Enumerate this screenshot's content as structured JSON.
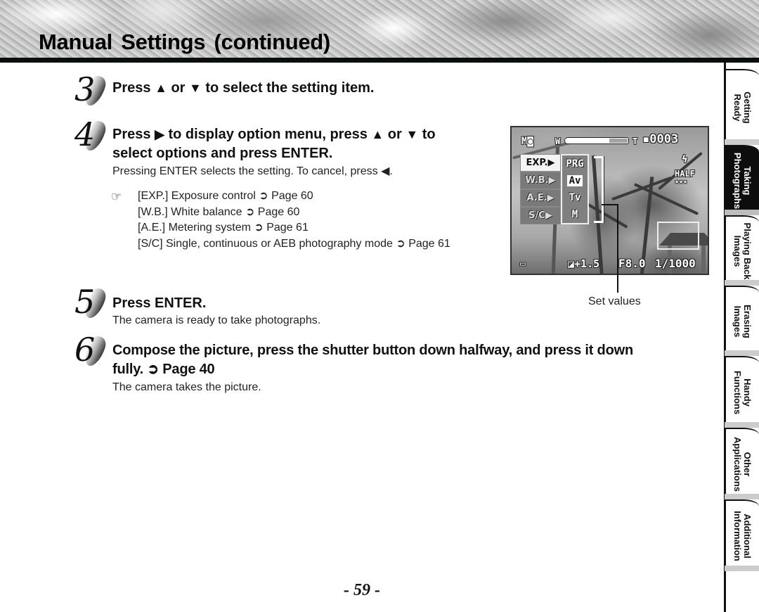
{
  "header": {
    "title": "Manual Settings (continued)"
  },
  "steps": [
    {
      "number": "3",
      "heading_parts": [
        "Press ",
        "▲",
        " or ",
        "▼",
        " to select the setting item."
      ]
    },
    {
      "number": "4",
      "heading_line1_parts": [
        "Press ",
        "▶",
        " to display option menu, press ",
        "▲",
        " or ",
        "▼",
        " to"
      ],
      "heading_line2": "select options and press ENTER.",
      "body": "Pressing ENTER selects the setting. To cancel, press ◀.",
      "note_icon": "☞",
      "notes": [
        "[EXP.] Exposure control ➲ Page 60",
        "[W.B.] White balance ➲ Page 60",
        "[A.E.] Metering system ➲ Page 61",
        "[S/C] Single, continuous or AEB photography mode ➲ Page 61"
      ]
    },
    {
      "number": "5",
      "heading": "Press ENTER.",
      "body": "The camera is ready to take photographs."
    },
    {
      "number": "6",
      "heading_line1": "Compose the picture, press the shutter button down halfway, and press it down",
      "heading_line2": "fully. ➲ Page 40",
      "body": "The camera takes the picture."
    }
  ],
  "lcd": {
    "mode": "M",
    "zoom_w": "W",
    "zoom_t": "T",
    "zoom_level": 0.7,
    "frame_count": "0003",
    "flash": "ϟ",
    "quality": "HALF",
    "quality_stars": "★★★",
    "menu_items": [
      "EXP.▶",
      "W.B.▶",
      "A.E.▶",
      "S/C▶"
    ],
    "selected_menu_index": 0,
    "options": [
      "PRG",
      "Av",
      "Tv",
      "M"
    ],
    "selected_option_index": 1,
    "exposure_comp": "+1.5",
    "aperture": "F8.0",
    "shutter": "1/1000",
    "annotation": "Set values"
  },
  "side_tabs": [
    {
      "label": "Getting Ready",
      "active": false
    },
    {
      "label": "Taking Photographs",
      "active": true
    },
    {
      "label": "Playing Back Images",
      "active": false
    },
    {
      "label": "Erasing Images",
      "active": false
    },
    {
      "label": "Handy Functions",
      "active": false
    },
    {
      "label": "Other Applications",
      "active": false
    },
    {
      "label": "Additional Information",
      "active": false
    }
  ],
  "page_number": "- 59 -"
}
